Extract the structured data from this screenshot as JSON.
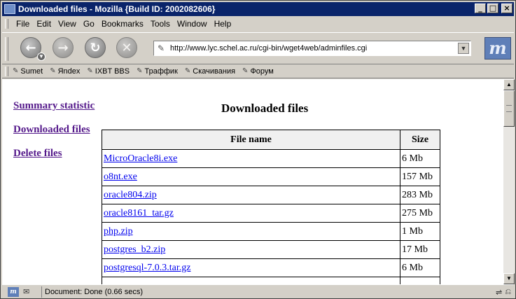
{
  "window": {
    "title": "Downloaded files - Mozilla {Build ID: 2002082606}",
    "controls": {
      "minimize": "_",
      "maximize": "□",
      "close": "×"
    }
  },
  "menu": [
    "File",
    "Edit",
    "View",
    "Go",
    "Bookmarks",
    "Tools",
    "Window",
    "Help"
  ],
  "nav": {
    "back_icon": "back-arrow-icon",
    "forward_icon": "forward-arrow-icon",
    "reload_icon": "reload-icon",
    "stop_icon": "stop-icon",
    "url": "http://www.lyc.schel.ac.ru/cgi-bin/wget4web/adminfiles.cgi"
  },
  "bookmarks": [
    "Sumet",
    "Яndex",
    "IXBT BBS",
    "Траффик",
    "Скачивания",
    "Форум"
  ],
  "page": {
    "title": "Downloaded files",
    "left_links": [
      "Summary statistic",
      "Downloaded files",
      "Delete files"
    ],
    "table": {
      "headers": [
        "File name",
        "Size"
      ],
      "rows": [
        [
          "MicroOracle8i.exe",
          "6 Mb"
        ],
        [
          "o8nt.exe",
          "157 Mb"
        ],
        [
          "oracle804.zip",
          "283 Mb"
        ],
        [
          "oracle8161_tar.gz",
          "275 Mb"
        ],
        [
          "php.zip",
          "1 Mb"
        ],
        [
          "postgres_b2.zip",
          "17 Mb"
        ],
        [
          "postgresql-7.0.3.tar.gz",
          "6 Mb"
        ],
        [
          "",
          ""
        ]
      ]
    }
  },
  "status": {
    "text": "Document: Done (0.66 secs)"
  },
  "colors": {
    "titlebar": "#0a246a",
    "link_visited": "#551a8b",
    "link": "#0000ee"
  }
}
